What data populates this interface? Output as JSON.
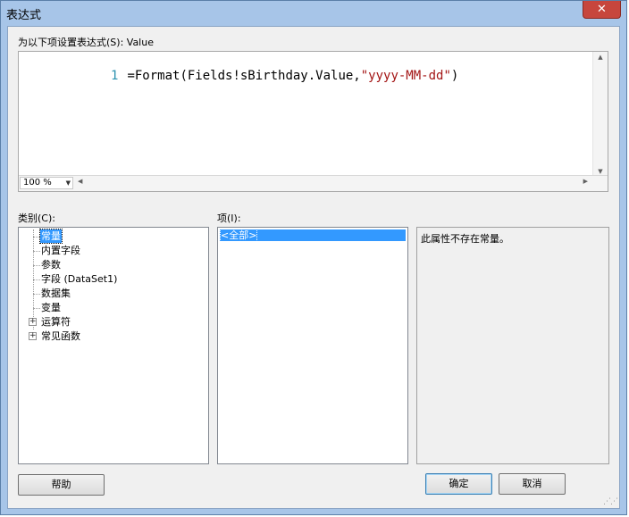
{
  "window": {
    "title": "表达式",
    "close_icon": "✕"
  },
  "expression": {
    "label": "为以下项设置表达式(S): Value",
    "line_number": "1",
    "code_prefix": "=Format(Fields!sBirthday.Value,",
    "code_string": "\"yyyy-MM-dd\"",
    "code_suffix": ")",
    "zoom": "100 %"
  },
  "category": {
    "label": "类别(C):",
    "items": [
      {
        "label": "常量",
        "selected": true
      },
      {
        "label": "内置字段"
      },
      {
        "label": "参数"
      },
      {
        "label": "字段 (DataSet1)"
      },
      {
        "label": "数据集"
      },
      {
        "label": "变量"
      },
      {
        "label": "运算符",
        "expandable": true
      },
      {
        "label": "常见函数",
        "expandable": true
      }
    ]
  },
  "items_list": {
    "label": "项(I):",
    "items": [
      {
        "label": "<全部>",
        "selected": true
      }
    ]
  },
  "description": {
    "text": "此属性不存在常量。"
  },
  "buttons": {
    "help": "帮助",
    "ok": "确定",
    "cancel": "取消"
  },
  "colors": {
    "selection": "#3399ff",
    "string_literal": "#a31515",
    "line_number": "#2b91af",
    "close": "#c7463d"
  }
}
